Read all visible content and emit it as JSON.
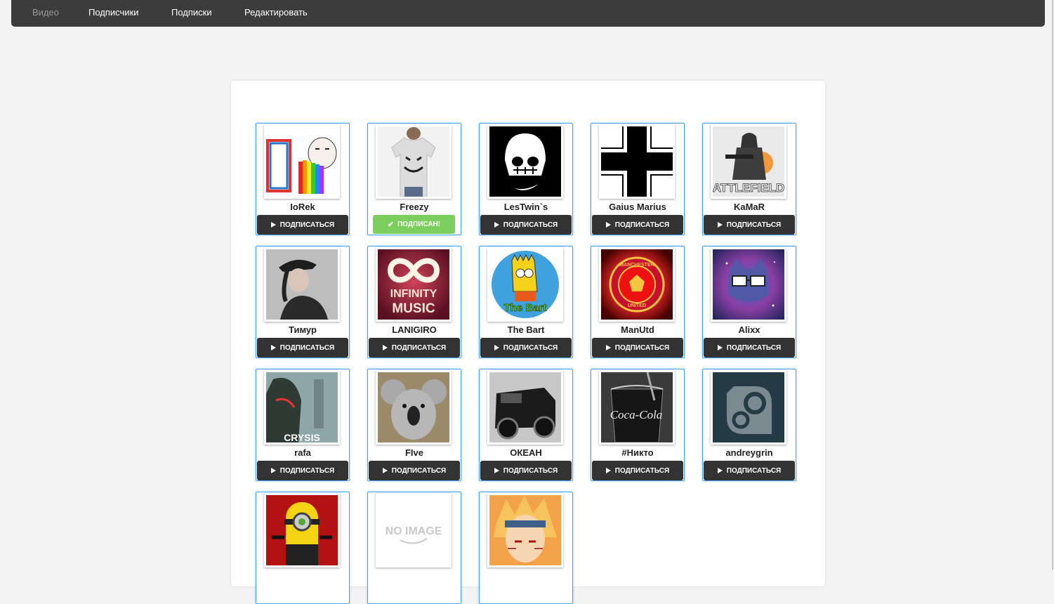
{
  "nav": {
    "items": [
      {
        "label": "Видео",
        "active": true
      },
      {
        "label": "Подписчики",
        "active": false
      },
      {
        "label": "Подписки",
        "active": false
      },
      {
        "label": "Редактировать",
        "active": false
      }
    ]
  },
  "colors": {
    "nav_bg": "#3c3c3c",
    "card_border": "#4aa3ee",
    "button_dark": "#333333",
    "button_subscribed": "#7ccf5e"
  },
  "subscribe_label": "ПОДПИСАТЬСЯ",
  "subscribed_label": "ПОДПИСАН!",
  "users": [
    {
      "name": "IoRek",
      "subscribed": false,
      "avatar": "rainbow-meme-avatar"
    },
    {
      "name": "Freezy",
      "subscribed": true,
      "avatar": "joker-tshirt-avatar"
    },
    {
      "name": "LesTwin`s",
      "subscribed": false,
      "avatar": "skull-helmet-avatar"
    },
    {
      "name": "Gaius Marius",
      "subscribed": false,
      "avatar": "iron-cross-avatar"
    },
    {
      "name": "KaMaR",
      "subscribed": false,
      "avatar": "battlefield-soldier-avatar"
    },
    {
      "name": "Тимур",
      "subscribed": false,
      "avatar": "officer-woman-avatar"
    },
    {
      "name": "LANIGIRO",
      "subscribed": false,
      "avatar": "infinity-music-avatar"
    },
    {
      "name": "The Bart",
      "subscribed": false,
      "avatar": "bart-simpson-avatar"
    },
    {
      "name": "ManUtd",
      "subscribed": false,
      "avatar": "manchester-united-avatar"
    },
    {
      "name": "Alixx",
      "subscribed": false,
      "avatar": "space-cat-avatar"
    },
    {
      "name": "rafa",
      "subscribed": false,
      "avatar": "crysis-avatar"
    },
    {
      "name": "FIve",
      "subscribed": false,
      "avatar": "koala-avatar"
    },
    {
      "name": "ОКЕАН",
      "subscribed": false,
      "avatar": "black-suv-avatar"
    },
    {
      "name": "#Никто",
      "subscribed": false,
      "avatar": "coca-cola-glass-avatar"
    },
    {
      "name": "andreygrin",
      "subscribed": false,
      "avatar": "gears-avatar"
    },
    {
      "name": "",
      "subscribed": false,
      "avatar": "minion-avatar"
    },
    {
      "name": "",
      "subscribed": false,
      "avatar": "no-image-avatar"
    },
    {
      "name": "",
      "subscribed": false,
      "avatar": "naruto-avatar"
    }
  ],
  "avatar_texts": {
    "battlefield": "ATTLEFIELD",
    "infinity": [
      "INFINITY",
      "MUSIC"
    ],
    "bart": "The Bart",
    "manutd_top": "MANCHESTER",
    "manutd_bottom": "UNITED",
    "crysis": "CRYSIS",
    "coke": "Coca-Cola",
    "noimage": "NO IMAGE"
  }
}
